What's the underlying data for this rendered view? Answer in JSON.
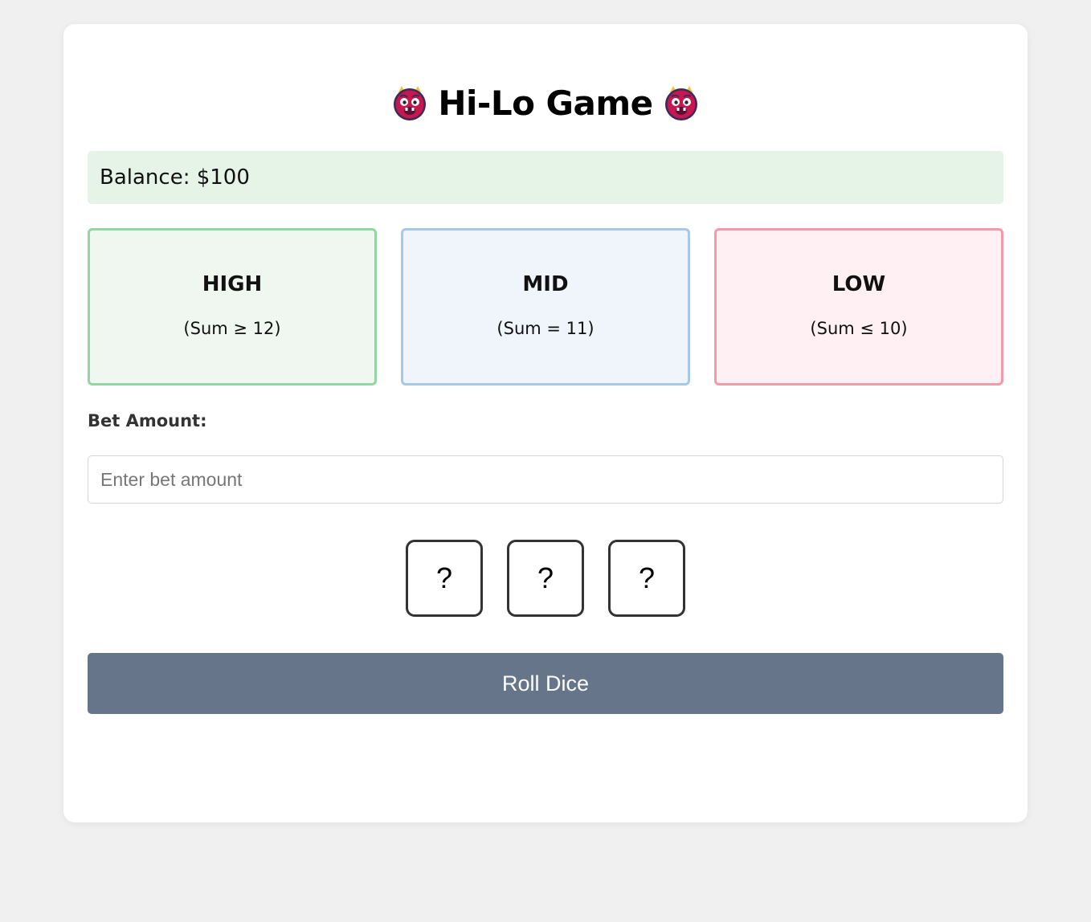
{
  "game": {
    "title": "Hi-Lo Game",
    "title_icon": "ogre-icon"
  },
  "balance": {
    "text": "Balance: $100"
  },
  "bet_options": [
    {
      "name": "HIGH",
      "rule": "(Sum ≥ 12)",
      "border_color": "#93d5a3",
      "background": "#f0f7f1"
    },
    {
      "name": "MID",
      "rule": "(Sum = 11)",
      "border_color": "#a8c8e8",
      "background": "#eff5fa"
    },
    {
      "name": "LOW",
      "rule": "(Sum ≤ 10)",
      "border_color": "#f29aa9",
      "background": "#fff0f3"
    }
  ],
  "bet": {
    "label": "Bet Amount:",
    "value": "",
    "placeholder": "Enter bet amount"
  },
  "dice": [
    "?",
    "?",
    "?"
  ],
  "roll_button": {
    "label": "Roll Dice",
    "color": "#66758a"
  },
  "colors": {
    "page_background": "#f0f0f0",
    "balance_background": "#e6f4e7"
  }
}
